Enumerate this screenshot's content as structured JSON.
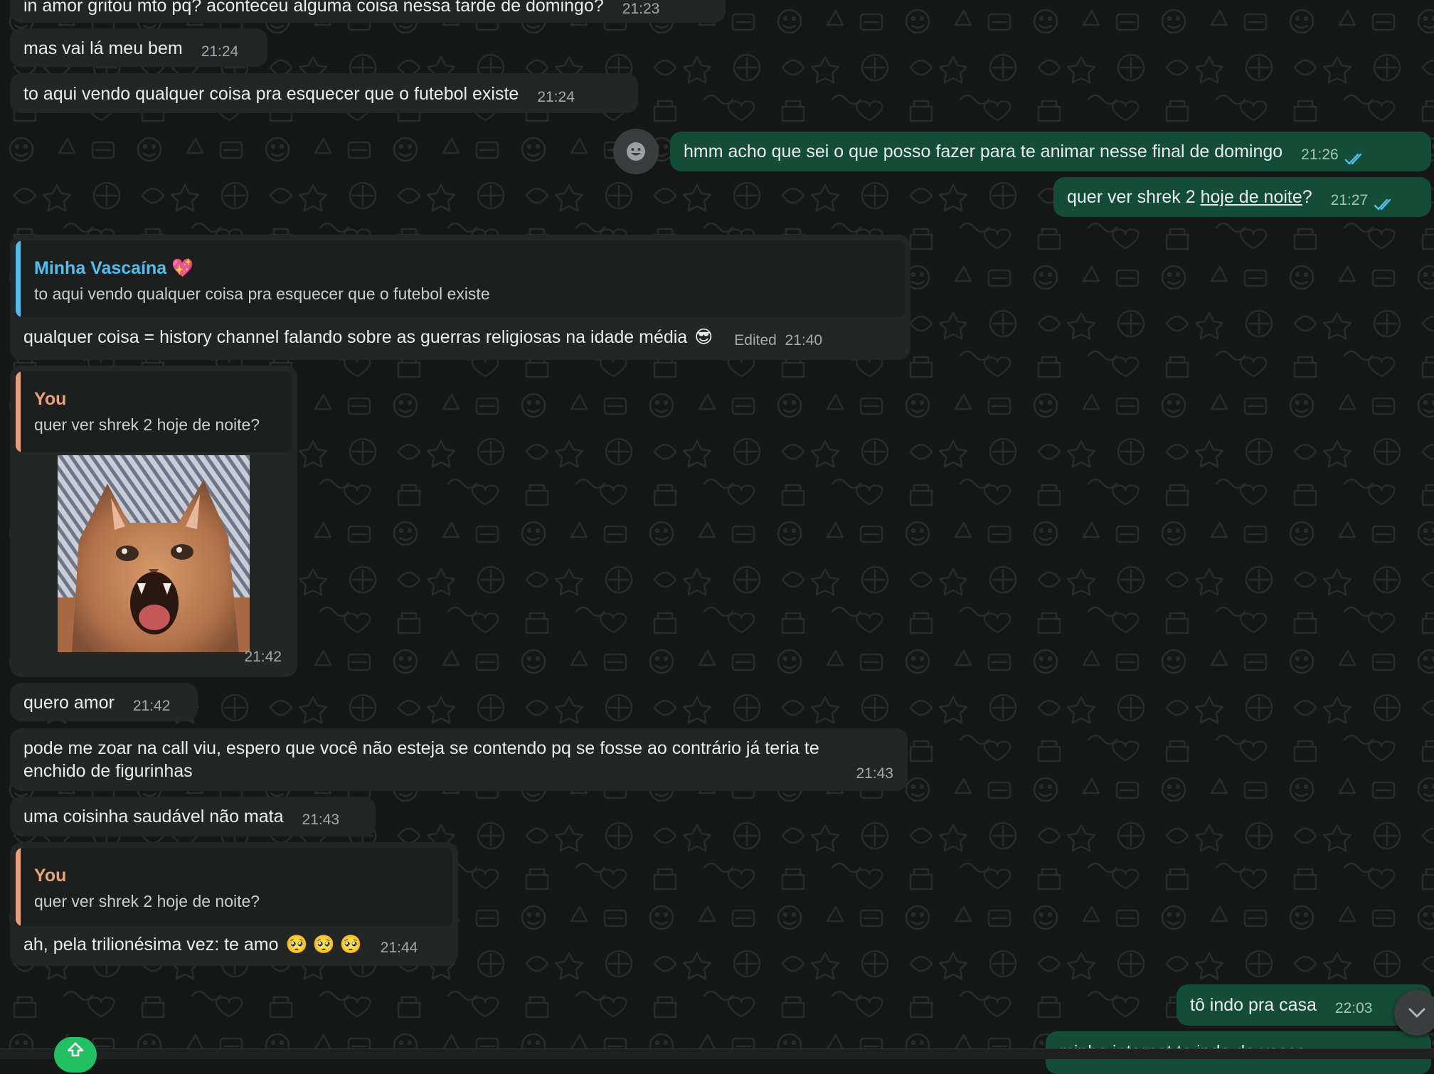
{
  "colors": {
    "incoming_bubble": "#242626",
    "outgoing_bubble": "#144d37",
    "quote_accent_contact": "#53bdeb",
    "quote_accent_you": "#e9a27b",
    "read_ticks": "#53bdeb",
    "background": "#161717"
  },
  "messages": [
    {
      "text": "in amor gritou mto pq? aconteceu alguma coisa nessa tarde de domingo?",
      "time": "21:23"
    },
    {
      "text": "mas vai lá meu bem",
      "time": "21:24"
    },
    {
      "text": "to aqui vendo qualquer coisa pra esquecer que o futebol existe",
      "time": "21:24"
    },
    {
      "text": "hmm acho que sei o que posso fazer para te animar nesse final de domingo",
      "time": "21:26",
      "status": "read"
    },
    {
      "text_before": "quer ver shrek 2 ",
      "link": "hoje de noite",
      "text_after": "?",
      "time": "21:27",
      "status": "read"
    },
    {
      "quote": {
        "author": "Minha Vascaína",
        "author_emoji": "💖",
        "text": "to aqui vendo qualquer coisa pra esquecer que o futebol existe"
      },
      "text": "qualquer coisa = history channel falando sobre as guerras religiosas na idade média",
      "emoji": "😎",
      "edited_label": "Edited",
      "time": "21:40"
    },
    {
      "quote": {
        "author": "You",
        "text": "quer ver shrek 2 hoje de noite?"
      },
      "sticker": "screaming-cat-sticker",
      "time": "21:42"
    },
    {
      "text": "quero amor",
      "time": "21:42"
    },
    {
      "text": "pode me zoar na call viu, espero que você não esteja se contendo pq se fosse ao contrário já teria te",
      "text_line2": "enchido de figurinhas",
      "time": "21:43"
    },
    {
      "text": "uma coisinha saudável não mata",
      "time": "21:43"
    },
    {
      "quote": {
        "author": "You",
        "text": "quer ver shrek 2 hoje de noite?"
      },
      "text": "ah, pela trilionésima vez: te amo",
      "emoji": "🥺 🥺 🥺",
      "time": "21:44"
    },
    {
      "text": "tô indo pra casa",
      "time": "22:03",
      "status": "read"
    },
    {
      "text": "minha internet ta indo de vasco",
      "status": "read"
    }
  ],
  "icons": {
    "reaction": "emoji-reaction-icon",
    "scroll_down": "chevron-down-icon",
    "upload": "upload-icon",
    "read_receipt": "double-check-icon"
  }
}
